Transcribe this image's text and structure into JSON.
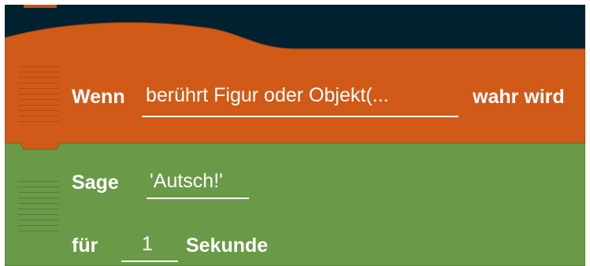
{
  "when_brick": {
    "keyword": "Wenn",
    "condition_value": "berührt Figur oder Objekt(...",
    "suffix": "wahr wird",
    "color": "#d15a18"
  },
  "say_brick": {
    "keyword": "Sage",
    "text_value": "'Autsch!'",
    "duration_prefix": "für",
    "duration_value": "1",
    "duration_unit": "Sekunde",
    "color": "#6a9a48"
  },
  "background_color": "#022130"
}
